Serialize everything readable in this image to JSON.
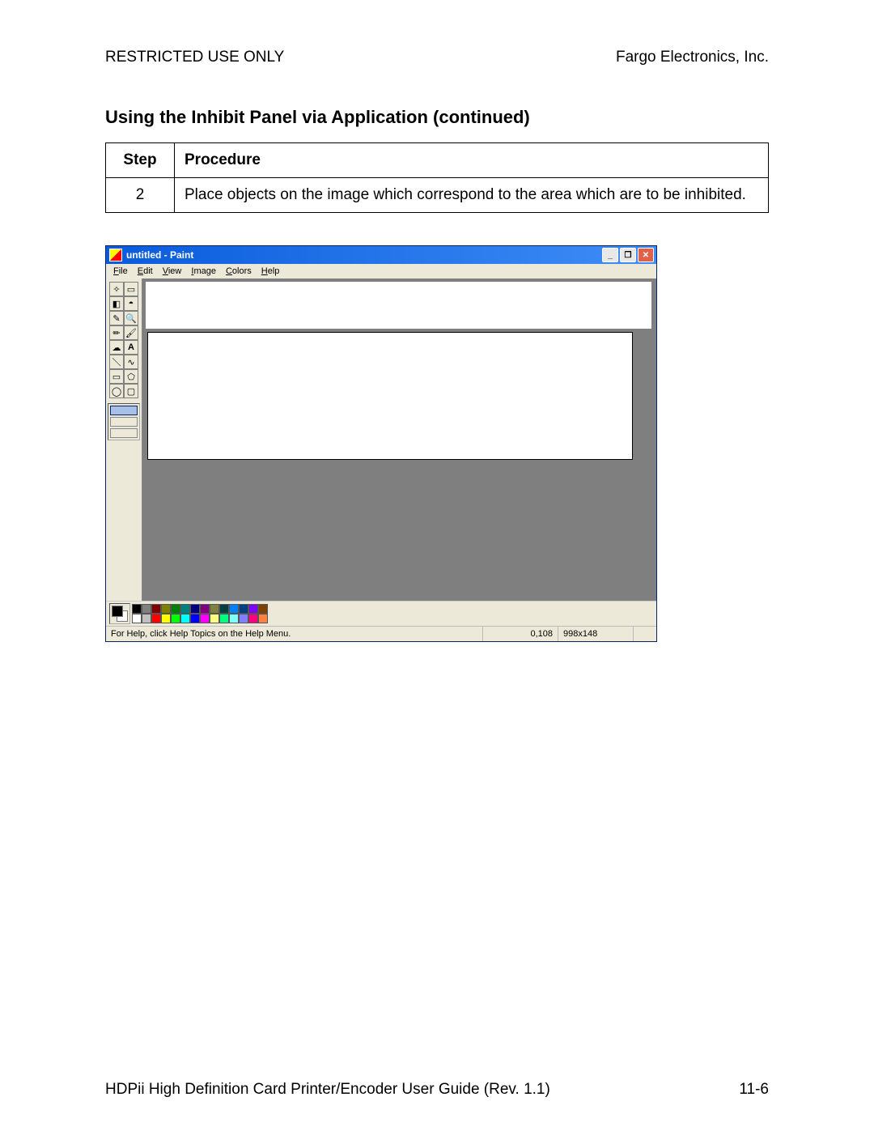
{
  "header": {
    "left": "RESTRICTED USE ONLY",
    "right": "Fargo Electronics, Inc."
  },
  "section_title": "Using the Inhibit Panel via Application (continued)",
  "table": {
    "head_step": "Step",
    "head_proc": "Procedure",
    "step_num": "2",
    "step_text": "Place objects on the image which correspond to the area which are to be inhibited."
  },
  "paint": {
    "title": "untitled - Paint",
    "menu": {
      "file": "File",
      "edit": "Edit",
      "view": "View",
      "image": "Image",
      "colors": "Colors",
      "help": "Help"
    },
    "status_help": "For Help, click Help Topics on the Help Menu.",
    "status_coord": "0,108",
    "status_dim": "998x148",
    "palette_top": [
      "#000000",
      "#808080",
      "#800000",
      "#808000",
      "#008000",
      "#008080",
      "#000080",
      "#800080",
      "#808040",
      "#004040",
      "#0080ff",
      "#004080",
      "#8000ff",
      "#804000"
    ],
    "palette_bot": [
      "#ffffff",
      "#c0c0c0",
      "#ff0000",
      "#ffff00",
      "#00ff00",
      "#00ffff",
      "#0000ff",
      "#ff00ff",
      "#ffff80",
      "#00ff80",
      "#80ffff",
      "#8080ff",
      "#ff0080",
      "#ff8040"
    ]
  },
  "footer": {
    "left": "HDPii High Definition Card Printer/Encoder User Guide (Rev. 1.1)",
    "right": "11-6"
  }
}
